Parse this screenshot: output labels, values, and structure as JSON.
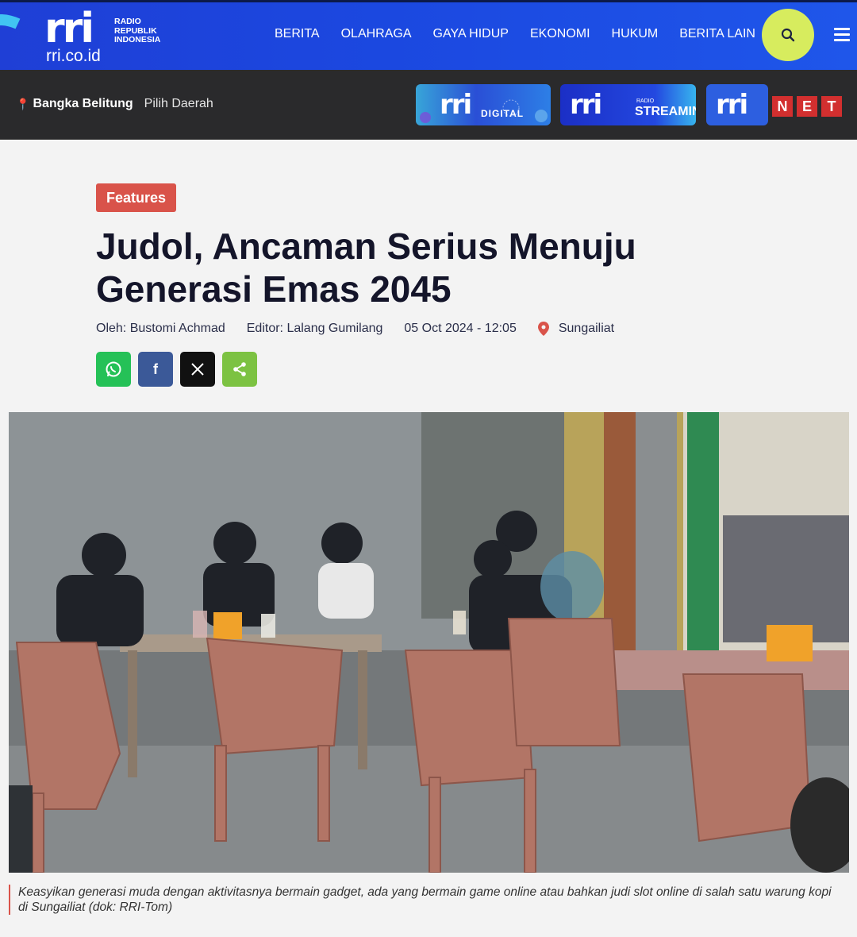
{
  "header": {
    "logo_text": "rri",
    "logo_subtitle_lines": [
      "RADIO",
      "REPUBLIK",
      "INDONESIA"
    ],
    "domain": "rri.co.id",
    "nav": [
      "BERITA",
      "OLAHRAGA",
      "GAYA HIDUP",
      "EKONOMI",
      "HUKUM",
      "BERITA LAIN"
    ],
    "search_icon": "search-icon",
    "menu_icon": "hamburger-menu-icon",
    "colors": {
      "header_blue": "#1f45dc",
      "search_btn": "#d7ec5e"
    }
  },
  "subbar": {
    "region": "Bangka Belitung",
    "pick_region": "Pilih Daerah",
    "badges": {
      "digital_logo": "rri",
      "digital_label": "DIGITAL",
      "stream_logo": "rri",
      "stream_radio": "RADIO",
      "stream_label": "STREAMING",
      "net_logo": "rri",
      "net_letters": [
        "N",
        "E",
        "T"
      ]
    }
  },
  "article": {
    "category": "Features",
    "title_line1": "Judol, Ancaman Serius Menuju",
    "title_line2": "Generasi Emas 2045",
    "author": "Oleh: Bustomi Achmad",
    "editor": "Editor: Lalang Gumilang",
    "datetime": "05 Oct 2024 - 12:05",
    "location": "Sungailiat",
    "share": [
      "whatsapp",
      "facebook",
      "x",
      "share"
    ],
    "image_alt": "Youths playing on phones at a coffee shop",
    "caption": "Keasyikan generasi muda dengan aktivitasnya bermain gadget, ada yang bermain game online atau bahkan judi slot online di salah satu warung kopi di Sungailiat (dok: RRI-Tom)"
  }
}
